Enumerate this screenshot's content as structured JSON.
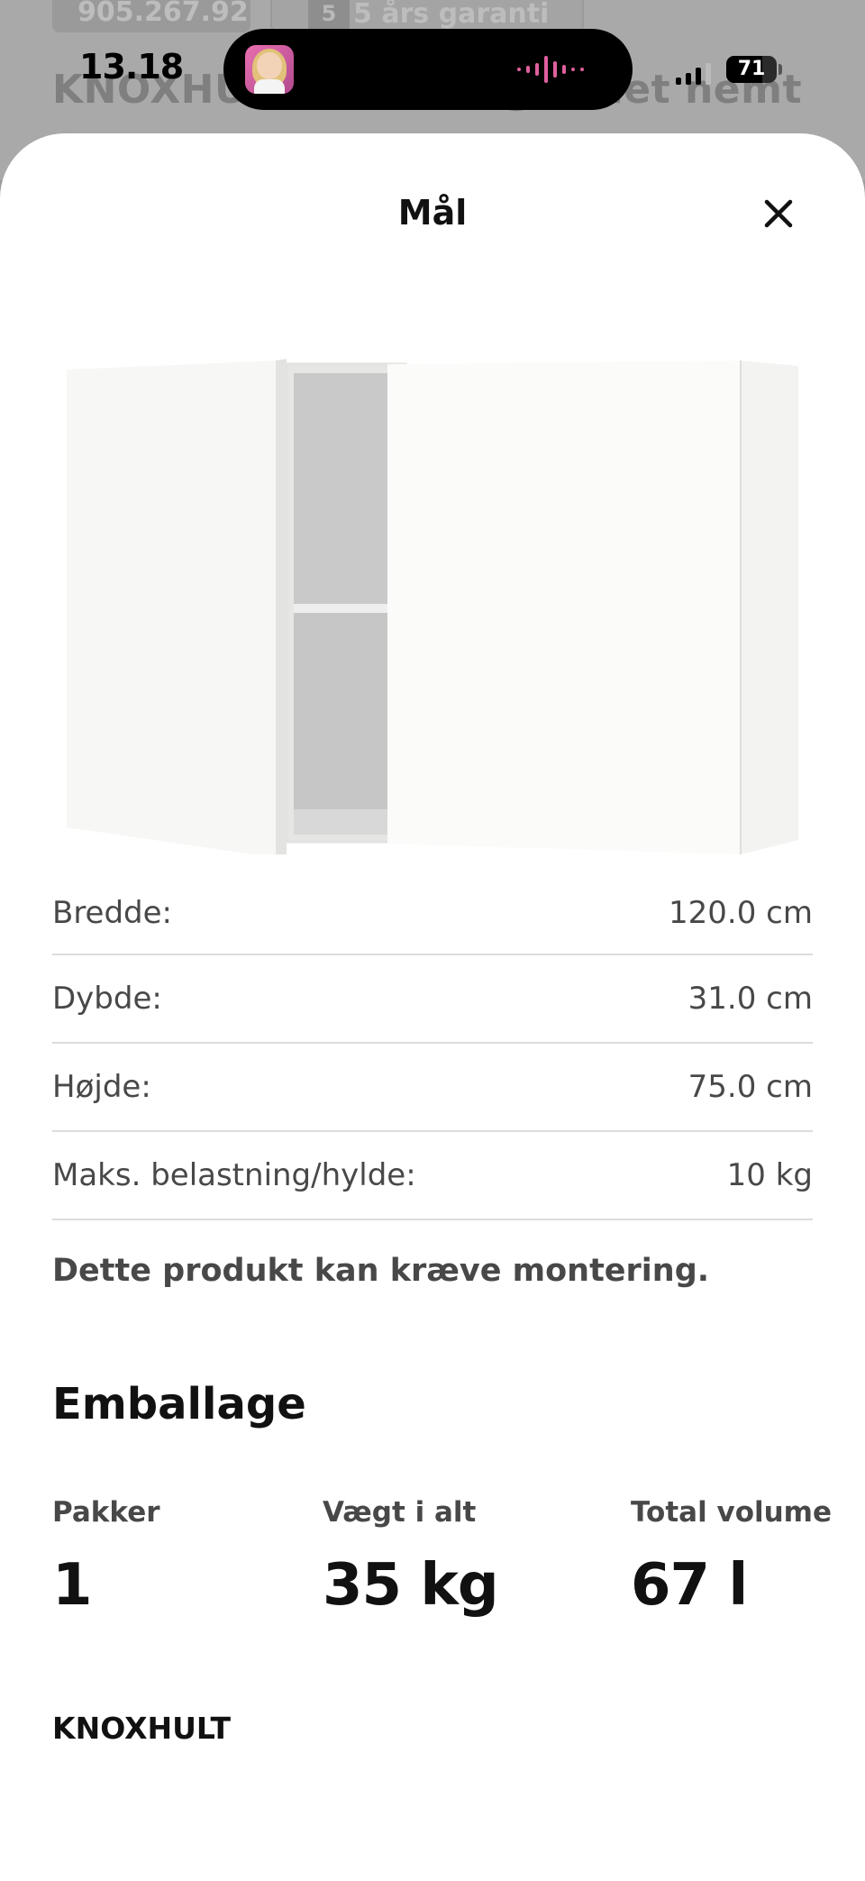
{
  "background": {
    "article_number": "905.267.92",
    "guarantee_years": "5",
    "guarantee_label": "5 års garanti",
    "headline_left": "KNOXHUL",
    "headline_right": "gør det nemt"
  },
  "status_bar": {
    "time": "13.18",
    "battery": "71"
  },
  "sheet": {
    "title": "Mål",
    "close_label": "Luk"
  },
  "dimensions": [
    {
      "label": "Bredde:",
      "value": "120.0 cm"
    },
    {
      "label": "Dybde:",
      "value": "31.0 cm"
    },
    {
      "label": "Højde:",
      "value": "75.0 cm"
    },
    {
      "label": "Maks. belastning/hylde:",
      "value": "10 kg"
    }
  ],
  "assembly_note": "Dette produkt kan kræve montering.",
  "packaging": {
    "heading": "Emballage",
    "packages_label": "Pakker",
    "packages_value": "1",
    "weight_label": "Vægt i alt",
    "weight_value": "35 kg",
    "volume_label": "Total volume",
    "volume_value": "67 l"
  },
  "product_name": "KNOXHULT",
  "colors": {
    "sheet_background": "#ffffff",
    "overlay": "#9c9c9c",
    "divider": "#dcdcdc",
    "text_secondary": "#484848",
    "audio_wave": "#e0609e"
  },
  "icons": {
    "close": "close-icon",
    "audio": "audio-wave-icon",
    "signal": "cellular-signal-icon",
    "battery": "battery-icon"
  }
}
